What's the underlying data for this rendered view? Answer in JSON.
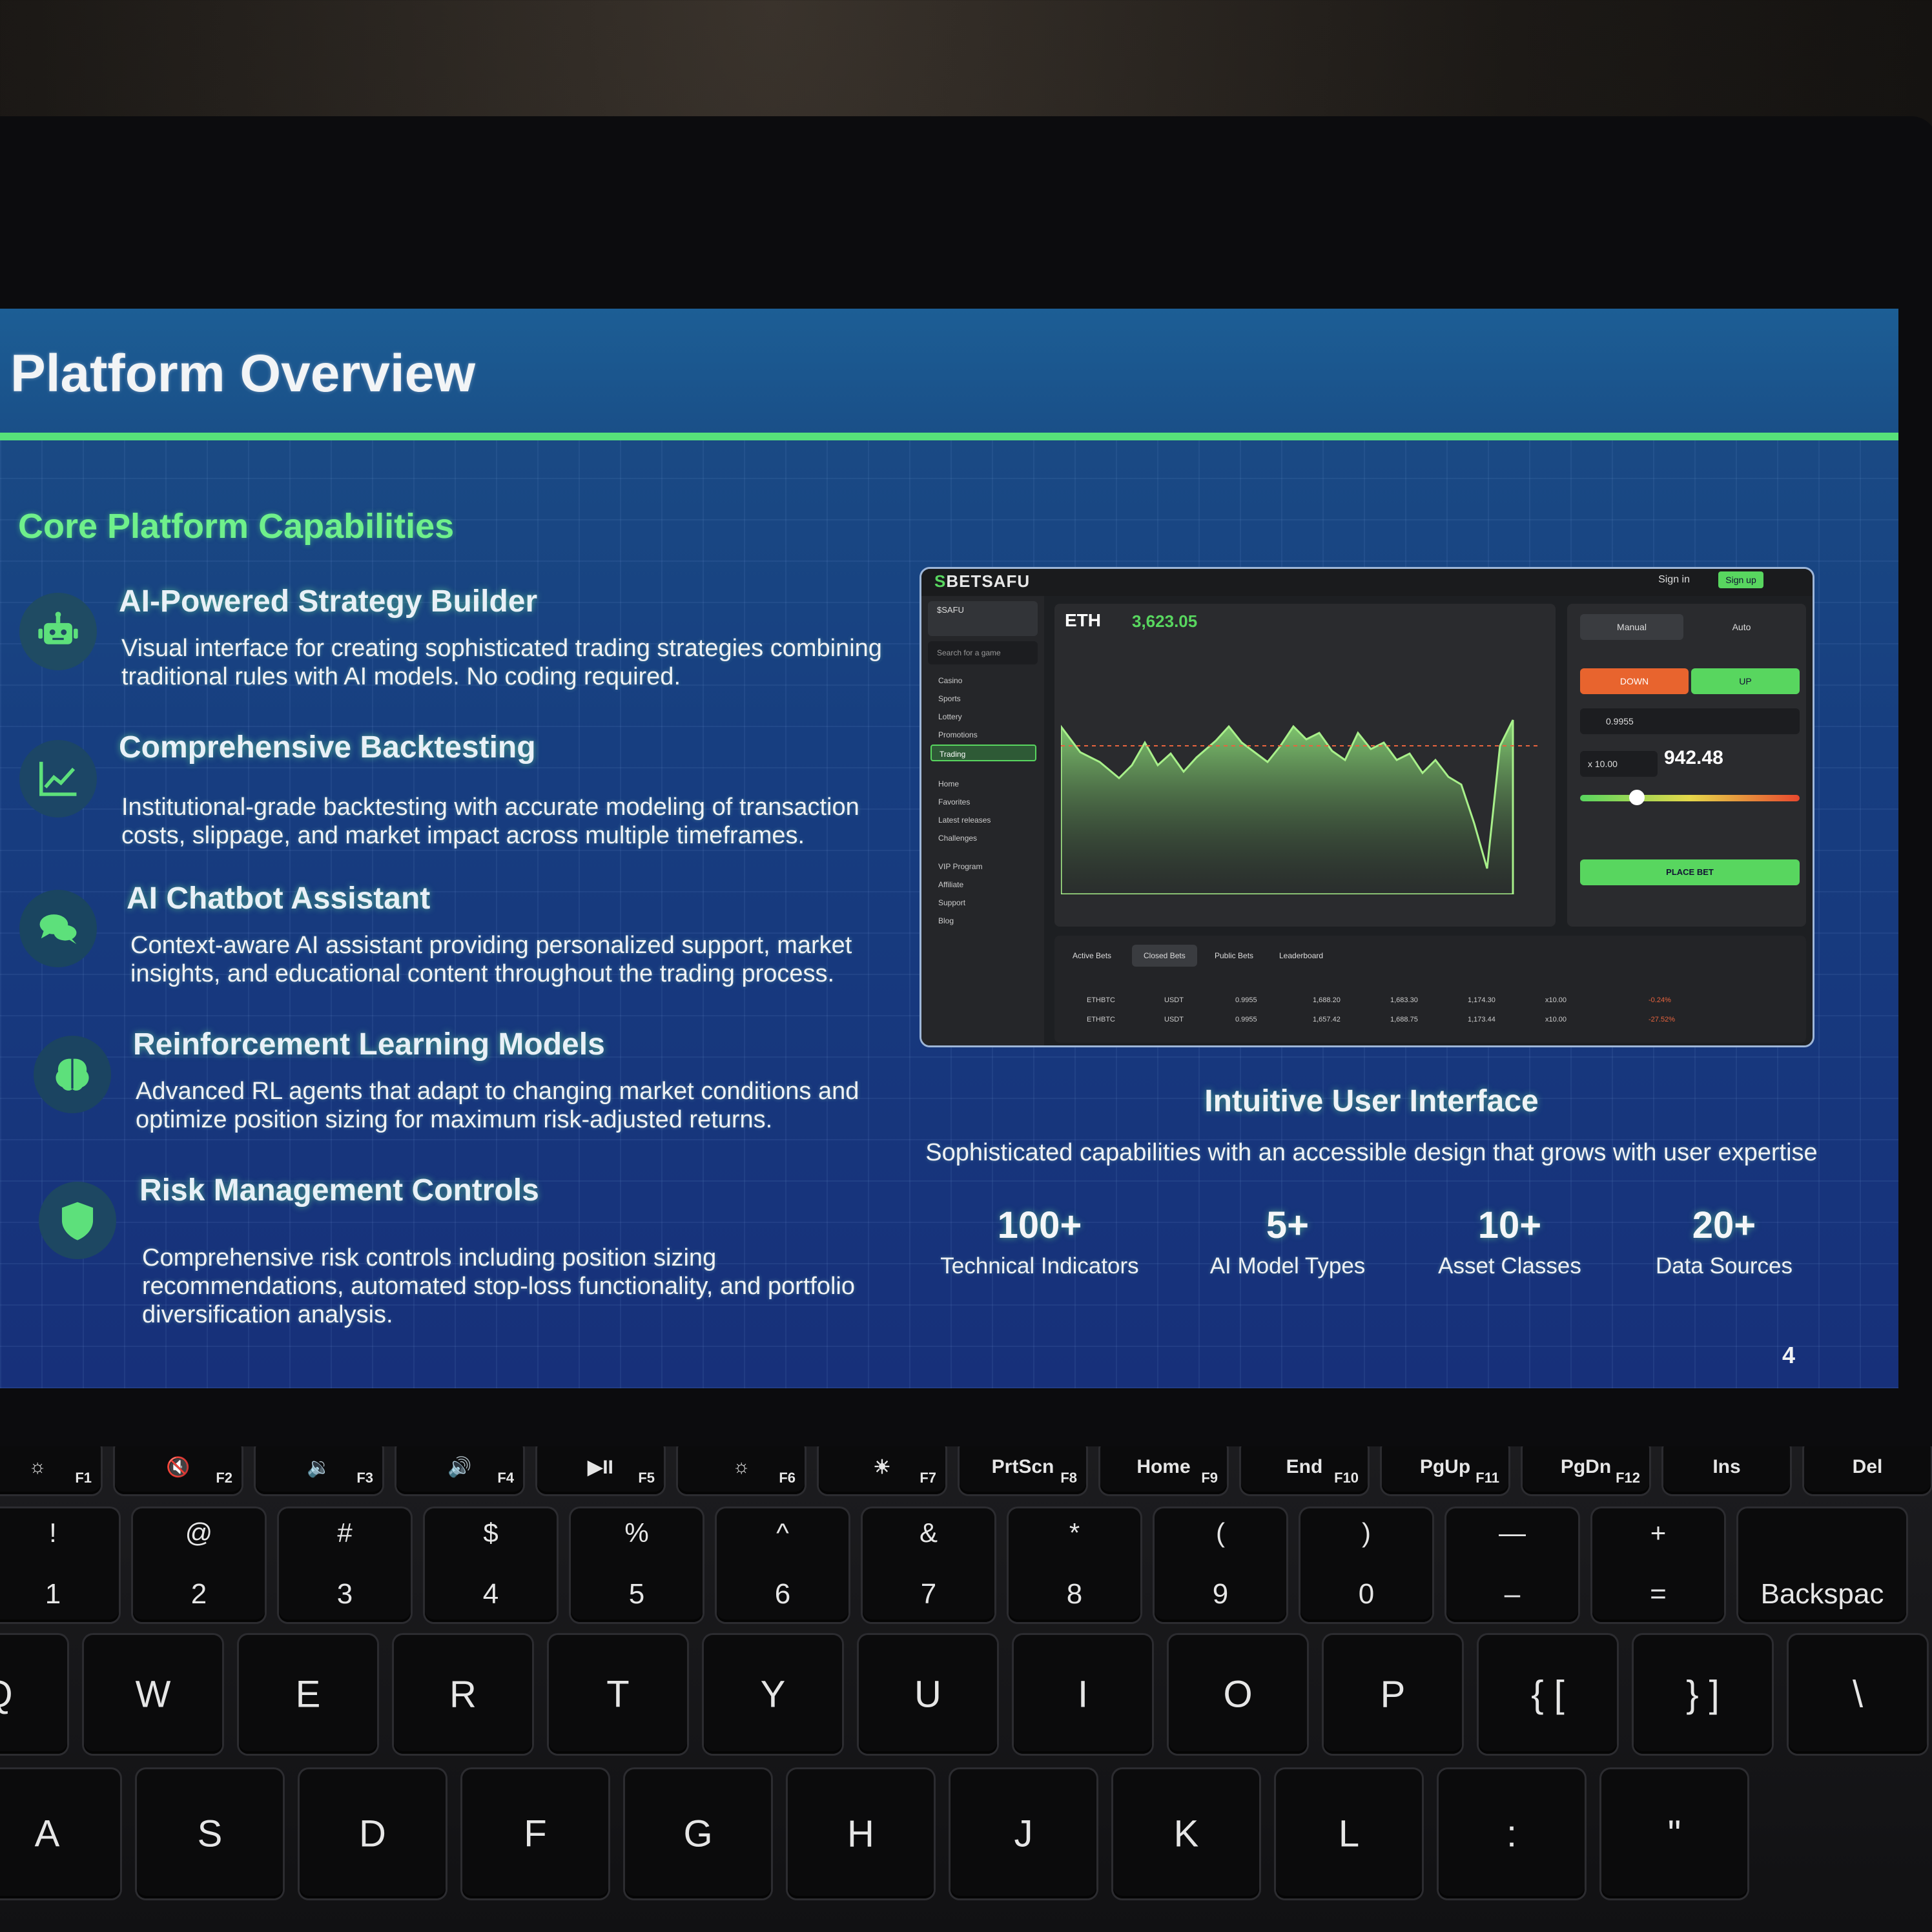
{
  "slide": {
    "title": "Platform Overview",
    "section_title": "Core Platform Capabilities",
    "features": [
      {
        "icon": "robot-icon",
        "title": "AI-Powered Strategy Builder",
        "description": "Visual interface for creating sophisticated trading strategies combining traditional rules with AI models. No coding required."
      },
      {
        "icon": "chart-line-icon",
        "title": "Comprehensive Backtesting",
        "description": "Institutional-grade backtesting with accurate modeling of transaction costs, slippage, and market impact across multiple timeframes."
      },
      {
        "icon": "chat-bubbles-icon",
        "title": "AI Chatbot Assistant",
        "description": "Context-aware AI assistant providing personalized support, market insights, and educational content throughout the trading process."
      },
      {
        "icon": "brain-icon",
        "title": "Reinforcement Learning Models",
        "description": "Advanced RL agents that adapt to changing market conditions and optimize position sizing for maximum risk-adjusted returns."
      },
      {
        "icon": "shield-icon",
        "title": "Risk Management Controls",
        "description": "Comprehensive risk controls including position sizing recommendations, automated stop-loss functionality, and portfolio diversification analysis."
      }
    ],
    "ui_heading": "Intuitive User Interface",
    "ui_subheading": "Sophisticated capabilities with an accessible design that grows with user expertise",
    "stats": [
      {
        "value": "100+",
        "label": "Technical Indicators"
      },
      {
        "value": "5+",
        "label": "AI Model Types"
      },
      {
        "value": "10+",
        "label": "Asset Classes"
      },
      {
        "value": "20+",
        "label": "Data Sources"
      }
    ],
    "page_number": "4",
    "accent_color": "#57e07a"
  },
  "app_screenshot": {
    "logo": "BETSAFU",
    "sign_in": "Sign in",
    "sign_up": "Sign up",
    "search_placeholder": "Search for a game",
    "sidebar_items": [
      "Casino",
      "Sports",
      "Lottery",
      "Promotions",
      "Trading",
      "Home",
      "Favorites",
      "Latest releases",
      "Challenges",
      "VIP Program",
      "Affiliate",
      "Support",
      "Blog"
    ],
    "active_item": "Trading",
    "asset": "ETH",
    "price": "3,623.05",
    "trade_tabs": [
      "Manual",
      "Auto"
    ],
    "down_label": "DOWN",
    "up_label": "UP",
    "wager": "0.9955",
    "multiplier": "x 10.00",
    "bust_price": "942.48",
    "place_bet": "PLACE BET",
    "bet_tabs": [
      "Active Bets",
      "Closed Bets",
      "Public Bets",
      "Leaderboard"
    ],
    "bet_rows": [
      {
        "pair": "ETHBTC",
        "currency": "USDT",
        "wager": "0.9955",
        "entry": "1,688.20",
        "exit": "1,683.30",
        "bust": "1,174.30",
        "mult": "x10.00",
        "roi": "-0.24%"
      },
      {
        "pair": "ETHBTC",
        "currency": "USDT",
        "wager": "0.9955",
        "entry": "1,657.42",
        "exit": "1,688.75",
        "bust": "1,173.44",
        "mult": "x10.00",
        "roi": "-27.52%"
      }
    ]
  },
  "keyboard": {
    "fn_row": [
      {
        "name": "☼",
        "num": "F1"
      },
      {
        "name": "🔇",
        "num": "F2"
      },
      {
        "name": "🔉",
        "num": "F3"
      },
      {
        "name": "🔊",
        "num": "F4"
      },
      {
        "name": "▶II",
        "num": "F5"
      },
      {
        "name": "☼",
        "num": "F6"
      },
      {
        "name": "☀",
        "num": "F7"
      },
      {
        "name": "PrtScn",
        "num": "F8"
      },
      {
        "name": "Home",
        "num": "F9"
      },
      {
        "name": "End",
        "num": "F10"
      },
      {
        "name": "PgUp",
        "num": "F11"
      },
      {
        "name": "PgDn",
        "num": "F12"
      },
      {
        "name": "Ins",
        "num": ""
      },
      {
        "name": "Del",
        "num": ""
      }
    ],
    "number_row": [
      {
        "top": "!",
        "bot": "1"
      },
      {
        "top": "@",
        "bot": "2"
      },
      {
        "top": "#",
        "bot": "3"
      },
      {
        "top": "$",
        "bot": "4"
      },
      {
        "top": "%",
        "bot": "5"
      },
      {
        "top": "^",
        "bot": "6"
      },
      {
        "top": "&",
        "bot": "7"
      },
      {
        "top": "*",
        "bot": "8"
      },
      {
        "top": "(",
        "bot": "9"
      },
      {
        "top": ")",
        "bot": "0"
      },
      {
        "top": "—",
        "bot": "–"
      },
      {
        "top": "+",
        "bot": "="
      },
      {
        "top": "",
        "bot": "Backspac"
      }
    ],
    "qwerty_row": [
      "Q",
      "W",
      "E",
      "R",
      "T",
      "Y",
      "U",
      "I",
      "O",
      "P",
      "{ [",
      "} ]",
      "\\"
    ],
    "home_row": [
      "A",
      "S",
      "D",
      "F",
      "G",
      "H",
      "J",
      "K",
      "L",
      ":",
      "\""
    ]
  }
}
